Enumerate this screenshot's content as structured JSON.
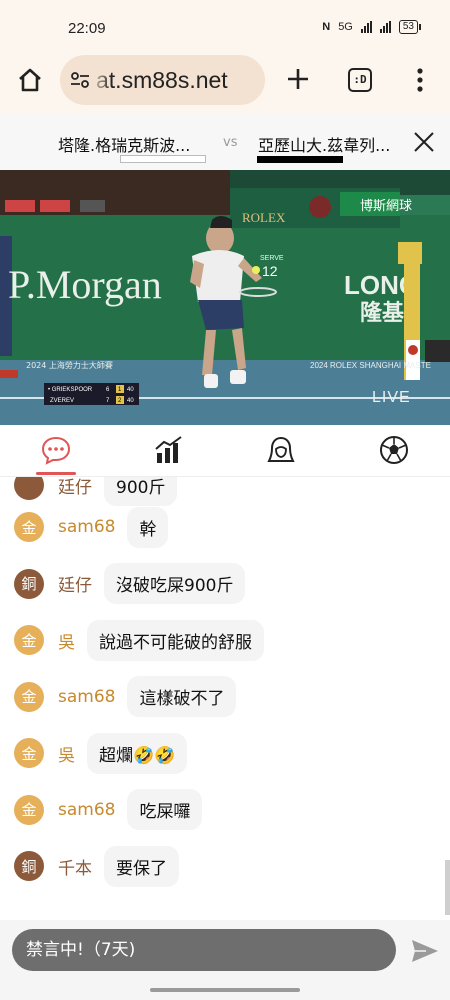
{
  "status_bar": {
    "time": "22:09",
    "network_label": "5G",
    "battery": "53"
  },
  "browser": {
    "url": "at.sm88s.net",
    "tab_count": ":D"
  },
  "match": {
    "team_a": "塔隆.格瑞克斯波...",
    "vs": "vs",
    "team_b": "亞歷山大.茲韋列...",
    "colors": {
      "team_a": "#ffffff",
      "team_b": "#000000"
    }
  },
  "video": {
    "banner_left": "P.Morgan",
    "banner_right": "LONG",
    "banner_right_cn": "隆基",
    "rolex": "ROLEX",
    "sponsor_green": "博斯網球",
    "event_left": "2024 上海勞力士大師賽",
    "event_right": "2024 ROLEX SHANGHAI MASTE",
    "serve_label": "SERVE",
    "serve_speed": "12",
    "live_label": "LIVE",
    "scoreboard": [
      {
        "player": "• GRIEKSPOOR",
        "s1": "6",
        "s2": "1",
        "pts": "40"
      },
      {
        "player": "ZVEREV",
        "s1": "7",
        "s2": "2",
        "pts": "40"
      }
    ]
  },
  "tabs": [
    "chat-icon",
    "stats-icon",
    "lineup-icon",
    "ball-icon"
  ],
  "chat": {
    "partial": {
      "badge": "",
      "user": "廷仔",
      "text": "900斤"
    },
    "messages": [
      {
        "badge": "金",
        "tier": "gold",
        "user": "sam68",
        "text": "幹"
      },
      {
        "badge": "銅",
        "tier": "bronze",
        "user": "廷仔",
        "text": "沒破吃屎900斤"
      },
      {
        "badge": "金",
        "tier": "gold",
        "user": "吳",
        "text": "說過不可能破的舒服"
      },
      {
        "badge": "金",
        "tier": "gold",
        "user": "sam68",
        "text": "這樣破不了"
      },
      {
        "badge": "金",
        "tier": "gold",
        "user": "吳",
        "text": "超爛🤣🤣"
      },
      {
        "badge": "金",
        "tier": "gold",
        "user": "sam68",
        "text": "吃屎囉"
      },
      {
        "badge": "銅",
        "tier": "bronze",
        "user": "千本",
        "text": "要保了"
      }
    ]
  },
  "input": {
    "mute_notice": "禁言中!（7天)"
  },
  "colors": {
    "accent": "#e05555",
    "gold_badge": "#e6b05a",
    "bronze_badge": "#8c5a3a",
    "gold_name": "#c78a2e"
  }
}
